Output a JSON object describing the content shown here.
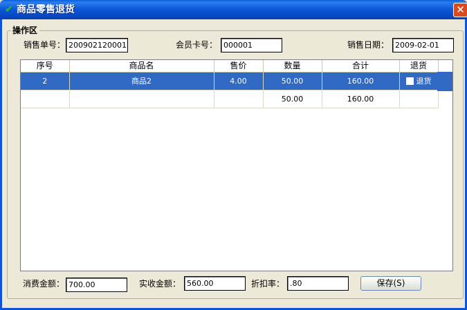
{
  "window": {
    "title": "商品零售退货",
    "close_glyph": "✕",
    "icon": "checkmark-icon"
  },
  "group": {
    "title": "操作区"
  },
  "header_fields": {
    "sale_no_label": "销售单号：",
    "sale_no_value": "200902120001",
    "member_card_label": "会员卡号：",
    "member_card_value": "000001",
    "sale_date_label": "销售日期：",
    "sale_date_value": "2009-02-01"
  },
  "grid": {
    "columns": [
      "序号",
      "商品名",
      "售价",
      "数量",
      "合计",
      "退货"
    ],
    "rows": [
      {
        "index": "2",
        "name": "商品2",
        "price": "4.00",
        "qty": "50.00",
        "total": "160.00",
        "return_label": "退货",
        "selected": true,
        "checked": false
      },
      {
        "index": "",
        "name": "",
        "price": "",
        "qty": "50.00",
        "total": "160.00",
        "return_label": "",
        "selected": false
      }
    ]
  },
  "footer": {
    "consume_label": "消费金额：",
    "consume_value": "700.00",
    "received_label": "实收金额：",
    "received_value": "560.00",
    "discount_label": "折扣率：",
    "discount_value": ".80",
    "save_label": "保存(S)"
  },
  "colors": {
    "title_bar": "#0b55d6",
    "selection": "#316ac5",
    "window_bg": "#ece9d8",
    "close_button": "#d84a1f",
    "check_icon": "#27b827"
  }
}
